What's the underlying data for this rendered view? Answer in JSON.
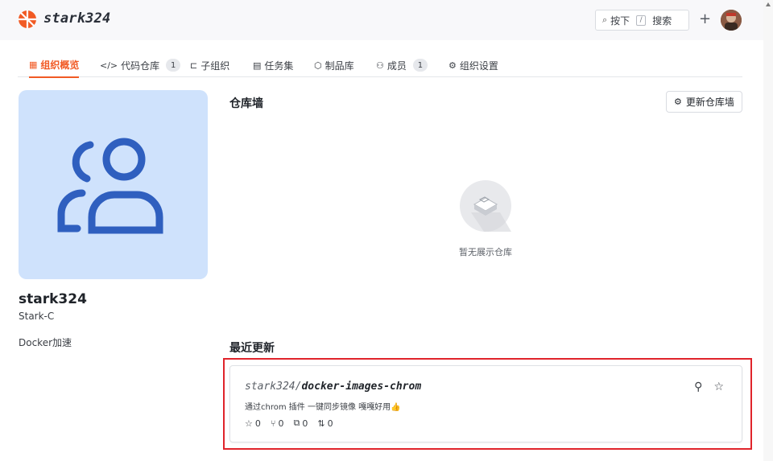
{
  "header": {
    "brand": "stark324",
    "search_label": "按下",
    "search_key": "/",
    "search_action": "搜索",
    "add_label": "+"
  },
  "tabs": [
    {
      "label": "组织概览",
      "icon": "grid-icon",
      "active": true
    },
    {
      "label": "代码仓库",
      "icon": "code-icon",
      "badge": "1"
    },
    {
      "label": "子组织",
      "icon": "sub-org-icon"
    },
    {
      "label": "任务集",
      "icon": "task-icon"
    },
    {
      "label": "制品库",
      "icon": "package-icon"
    },
    {
      "label": "成员",
      "icon": "members-icon",
      "badge": "1"
    },
    {
      "label": "组织设置",
      "icon": "settings-icon"
    }
  ],
  "org": {
    "name": "stark324",
    "subtitle": "Stark-C",
    "description": "Docker加速"
  },
  "repo_wall": {
    "title": "仓库墙",
    "update_button": "更新仓库墙",
    "empty_text": "暂无展示仓库"
  },
  "recent": {
    "title": "最近更新",
    "repo": {
      "owner": "stark324/",
      "name": "docker-images-chrom",
      "description": "通过chrom 插件 一键同步镜像 嘎嘎好用👍",
      "stars": "0",
      "forks": "0",
      "issues": "0",
      "pulls": "0"
    }
  },
  "colors": {
    "accent": "#f15a24",
    "avatar_bg": "#cfe2fc",
    "avatar_fg": "#2f5fbf",
    "highlight": "#e0242b"
  }
}
